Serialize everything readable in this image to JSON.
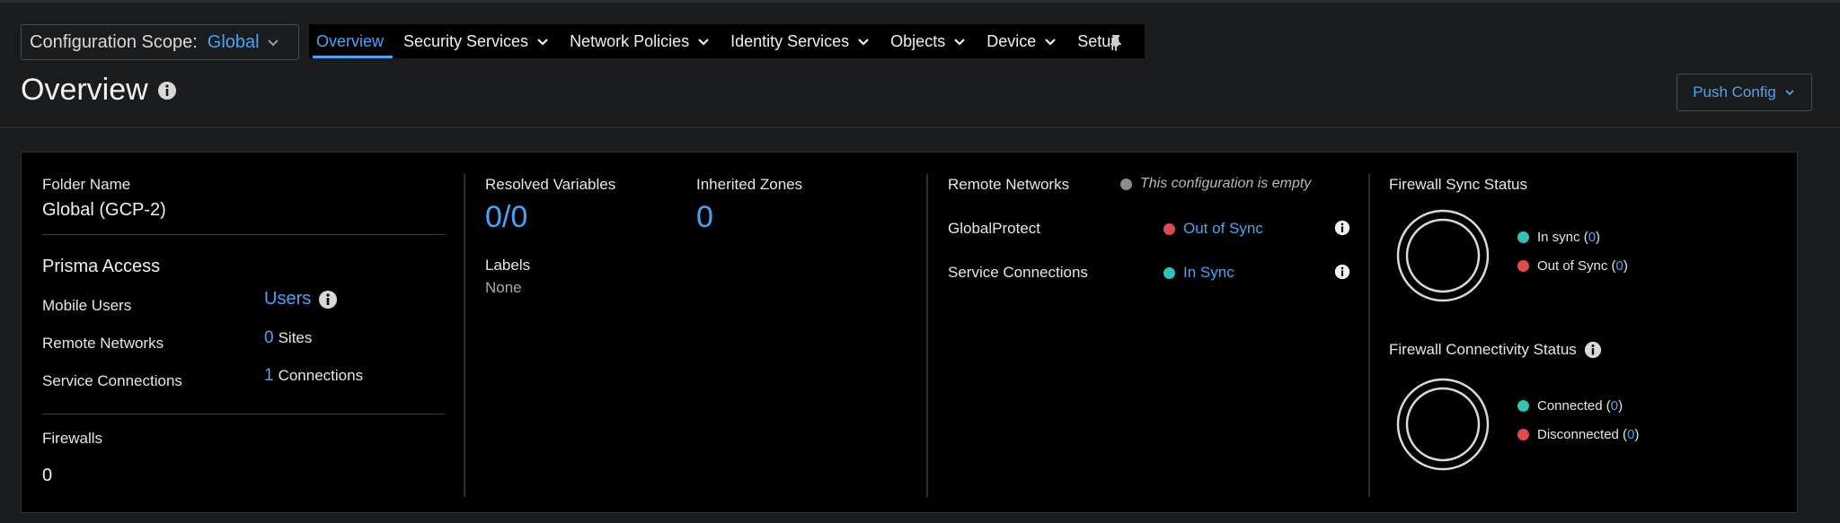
{
  "header": {
    "scope_label": "Configuration Scope:",
    "scope_value": "Global",
    "title": "Overview",
    "push_label": "Push Config",
    "nav": [
      {
        "label": "Overview",
        "active": true
      },
      {
        "label": "Security Services"
      },
      {
        "label": "Network Policies"
      },
      {
        "label": "Identity Services"
      },
      {
        "label": "Objects"
      },
      {
        "label": "Device"
      },
      {
        "label": "Setup"
      }
    ]
  },
  "folder": {
    "name_label": "Folder Name",
    "name_value": "Global (GCP-2)"
  },
  "prisma": {
    "title": "Prisma Access",
    "mobile_label": "Mobile Users",
    "mobile_value": "Users",
    "remote_label": "Remote Networks",
    "remote_count": "0",
    "remote_unit": "Sites",
    "service_label": "Service Connections",
    "service_count": "1",
    "service_unit": "Connections"
  },
  "firewalls": {
    "label": "Firewalls",
    "value": "0"
  },
  "variables": {
    "resolved_label": "Resolved Variables",
    "resolved_value": "0/0",
    "zones_label": "Inherited Zones",
    "zones_value": "0",
    "labels_label": "Labels",
    "labels_value": "None"
  },
  "sync": {
    "remote_label": "Remote Networks",
    "remote_status": "This configuration is empty",
    "gp_label": "GlobalProtect",
    "gp_status": "Out of Sync",
    "sc_label": "Service Connections",
    "sc_status": "In Sync"
  },
  "firewall_sync": {
    "title": "Firewall Sync Status",
    "in_sync_label": "In sync",
    "in_sync_count": "0",
    "out_sync_label": "Out of Sync",
    "out_sync_count": "0"
  },
  "firewall_conn": {
    "title": "Firewall Connectivity Status",
    "connected_label": "Connected",
    "connected_count": "0",
    "disconnected_label": "Disconnected",
    "disconnected_count": "0"
  },
  "colors": {
    "accent": "#4aa3f5",
    "in_sync": "#2ec4b6",
    "out_of_sync": "#e5484d",
    "neutral": "#8c8c8c"
  },
  "icons": {
    "scope_dropdown": "chevron-down-icon",
    "pin": "pin-icon",
    "info": "info-icon",
    "push_dropdown": "chevron-down-icon"
  }
}
